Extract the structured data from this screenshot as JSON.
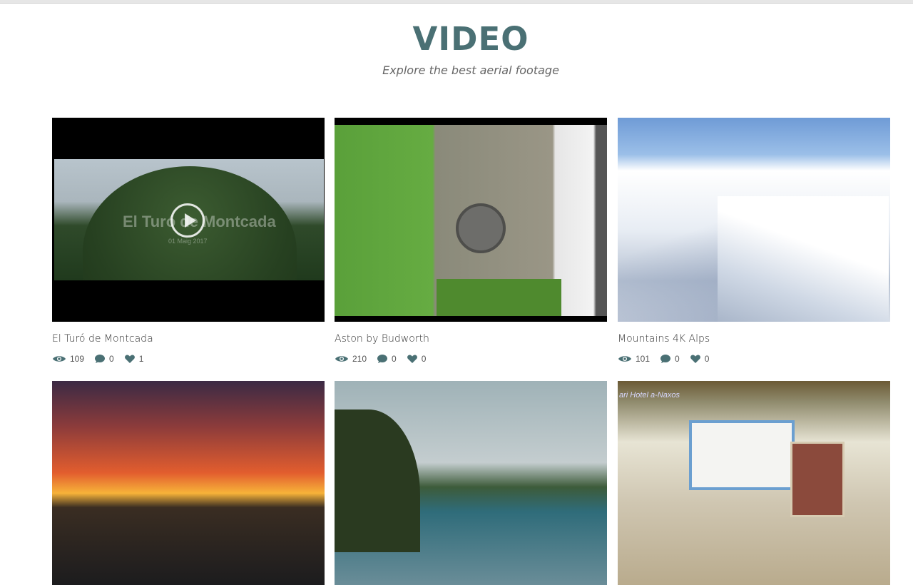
{
  "page": {
    "title": "VIDEO",
    "subtitle": "Explore the best aerial footage"
  },
  "videos": [
    {
      "title": "El Turó de Montcada",
      "views": "109",
      "comments": "0",
      "likes": "1",
      "overlay_title": "El Turó de Montcada",
      "overlay_date": "01 Maig 2017"
    },
    {
      "title": "Aston by Budworth",
      "views": "210",
      "comments": "0",
      "likes": "0"
    },
    {
      "title": "Mountains 4K Alps",
      "views": "101",
      "comments": "0",
      "likes": "0"
    },
    {
      "title": "",
      "views": "",
      "comments": "",
      "likes": ""
    },
    {
      "title": "",
      "views": "",
      "comments": "",
      "likes": ""
    },
    {
      "title": "",
      "views": "",
      "comments": "",
      "likes": "",
      "overlay_title": "ari Hotel a-Naxos"
    }
  ],
  "icons": {
    "views": "eye-icon",
    "comments": "speech-bubble-icon",
    "likes": "heart-icon"
  },
  "colors": {
    "accent": "#4a7074",
    "icon": "#4a7074"
  }
}
